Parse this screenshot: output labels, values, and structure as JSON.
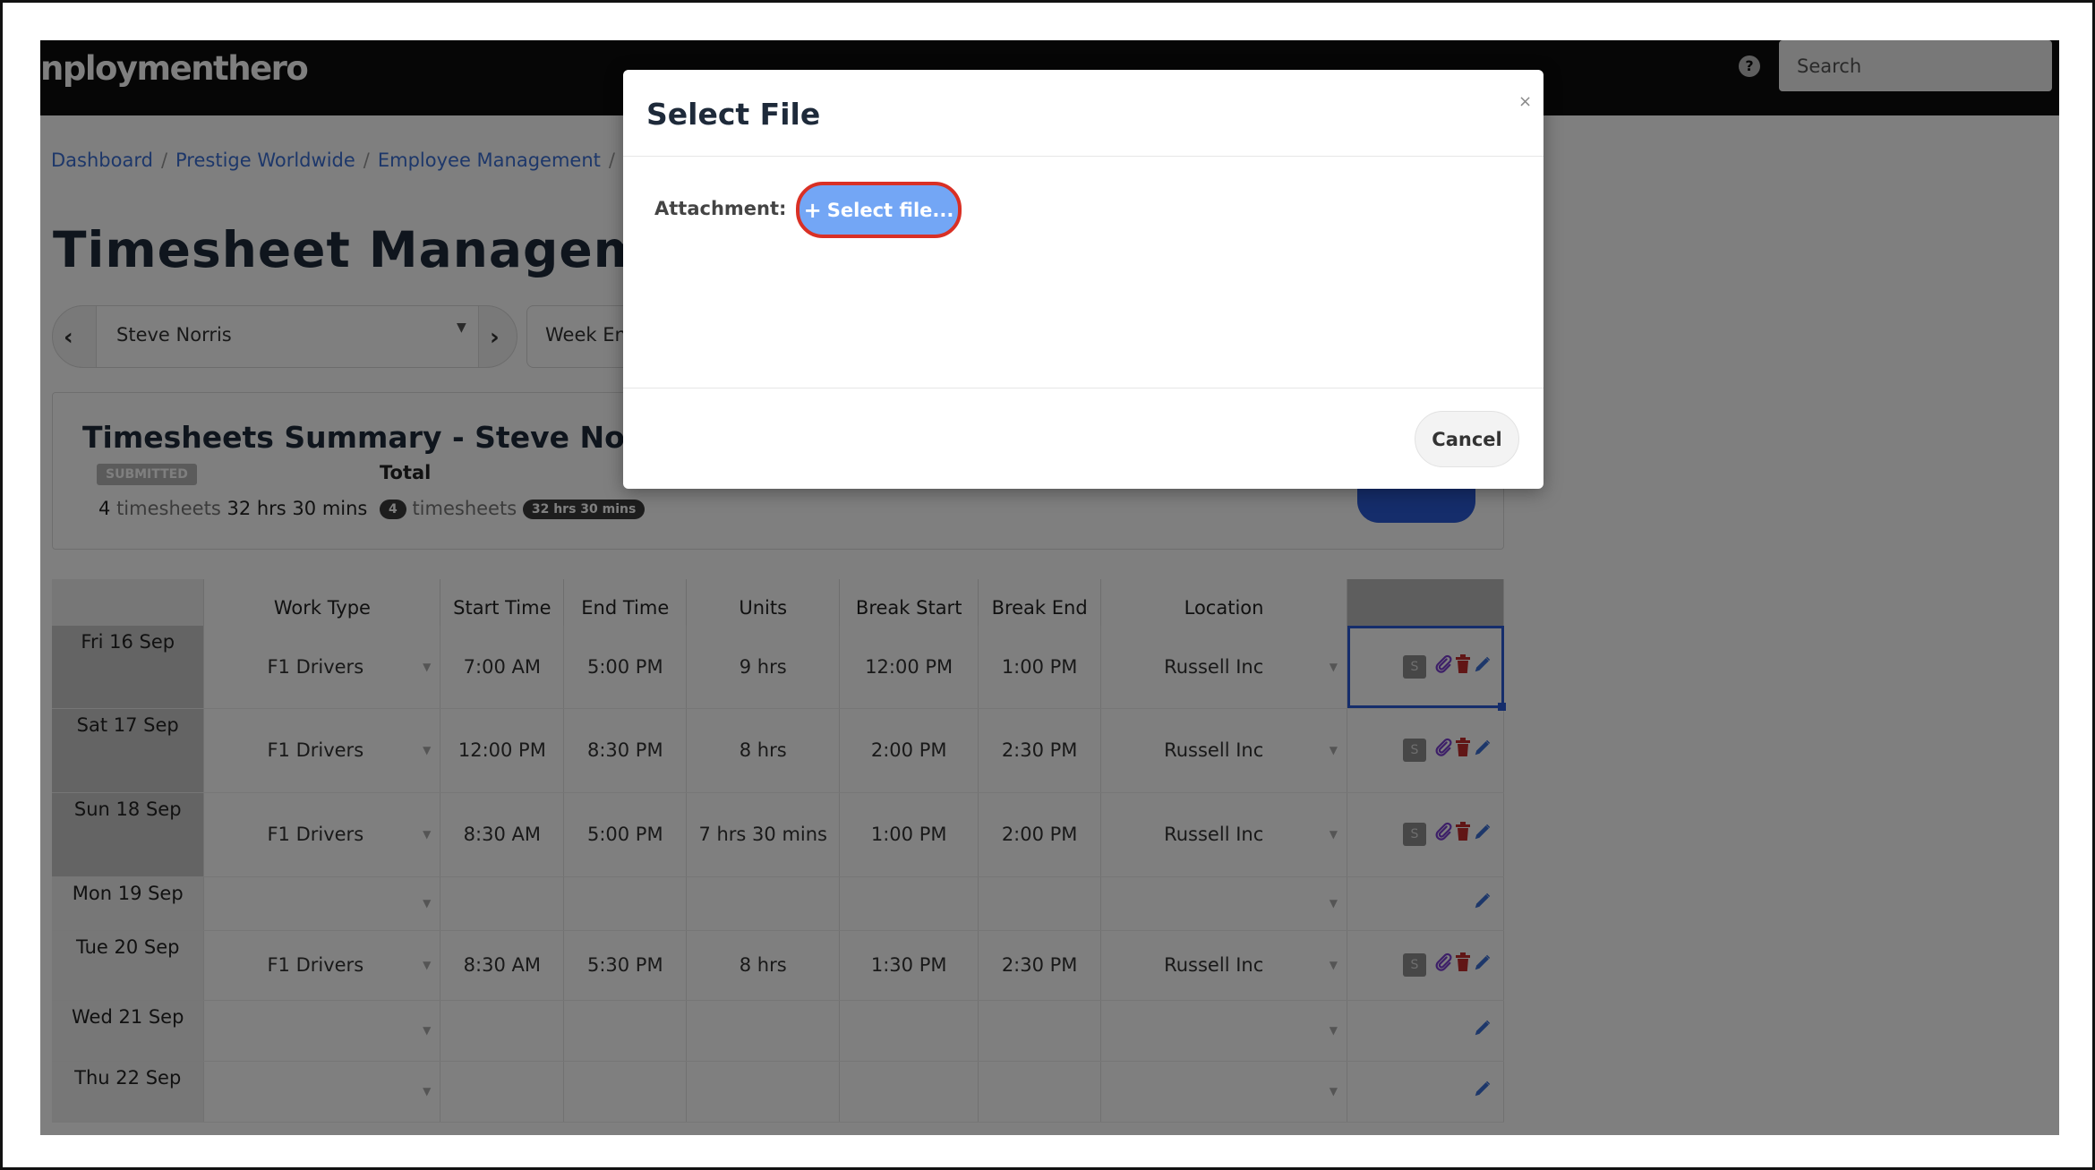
{
  "topbar": {
    "logo": "nploymenthero",
    "help_icon": "?",
    "search_placeholder": "Search"
  },
  "breadcrumb": [
    "Dashboard",
    "Prestige Worldwide",
    "Employee Management"
  ],
  "page_title": "Timesheet Management",
  "selectors": {
    "employee": "Steve Norris",
    "week": "Week En"
  },
  "summary": {
    "title": "Timesheets Summary - Steve Norris",
    "status_badge": "SUBMITTED",
    "count": "4",
    "count_word": "timesheets",
    "duration": "32 hrs 30 mins",
    "total_label": "Total",
    "total_count": "4",
    "total_word": "timesheets",
    "total_duration": "32 hrs 30 mins"
  },
  "table": {
    "headers": [
      "",
      "Work Type",
      "Start Time",
      "End Time",
      "Units",
      "Break Start",
      "Break End",
      "Location",
      ""
    ],
    "rows": [
      {
        "day": "Fri 16 Sep",
        "work_type": "F1 Drivers",
        "start": "7:00 AM",
        "end": "5:00 PM",
        "units": "9 hrs",
        "break_start": "12:00 PM",
        "break_end": "1:00 PM",
        "location": "Russell Inc",
        "has_entry": true
      },
      {
        "day": "Sat 17 Sep",
        "work_type": "F1 Drivers",
        "start": "12:00 PM",
        "end": "8:30 PM",
        "units": "8 hrs",
        "break_start": "2:00 PM",
        "break_end": "2:30 PM",
        "location": "Russell Inc",
        "has_entry": true
      },
      {
        "day": "Sun 18 Sep",
        "work_type": "F1 Drivers",
        "start": "8:30 AM",
        "end": "5:00 PM",
        "units": "7 hrs 30 mins",
        "break_start": "1:00 PM",
        "break_end": "2:00 PM",
        "location": "Russell Inc",
        "has_entry": true
      },
      {
        "day": "Mon 19 Sep",
        "work_type": "",
        "start": "",
        "end": "",
        "units": "",
        "break_start": "",
        "break_end": "",
        "location": "",
        "has_entry": false
      },
      {
        "day": "Tue 20 Sep",
        "work_type": "F1 Drivers",
        "start": "8:30 AM",
        "end": "5:30 PM",
        "units": "8 hrs",
        "break_start": "1:30 PM",
        "break_end": "2:30 PM",
        "location": "Russell Inc",
        "has_entry": true
      },
      {
        "day": "Wed 21 Sep",
        "work_type": "",
        "start": "",
        "end": "",
        "units": "",
        "break_start": "",
        "break_end": "",
        "location": "",
        "has_entry": false
      },
      {
        "day": "Thu 22 Sep",
        "work_type": "",
        "start": "",
        "end": "",
        "units": "",
        "break_start": "",
        "break_end": "",
        "location": "",
        "has_entry": false
      }
    ],
    "action_badge": "S"
  },
  "modal": {
    "title": "Select File",
    "close": "×",
    "attachment_label": "Attachment:",
    "select_file_label": "Select file...",
    "select_file_icon": "+",
    "cancel_label": "Cancel"
  },
  "colors": {
    "accent": "#2a5bd7",
    "select_file_button": "#73a6f5",
    "highlight_ring": "#d93025",
    "topbar": "#0c0c0c"
  }
}
